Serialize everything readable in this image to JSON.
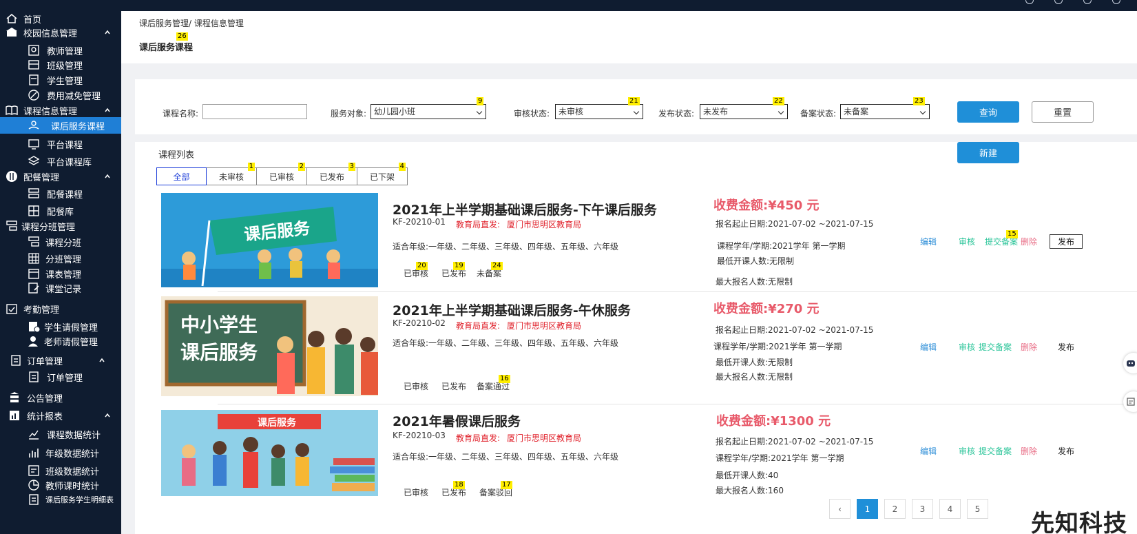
{
  "sidebar": {
    "items": [
      {
        "label": "首页",
        "level": 1,
        "icon": "home-icon"
      },
      {
        "label": "校园信息管理",
        "level": 1,
        "icon": "school-icon",
        "expanded": true
      },
      {
        "label": "教师管理",
        "level": 2,
        "icon": "teacher-icon"
      },
      {
        "label": "班级管理",
        "level": 2,
        "icon": "class-icon"
      },
      {
        "label": "学生管理",
        "level": 2,
        "icon": "student-icon"
      },
      {
        "label": "费用减免管理",
        "level": 2,
        "icon": "fee-icon"
      },
      {
        "label": "课程信息管理",
        "level": 1,
        "icon": "book-icon",
        "expanded": true
      },
      {
        "label": "课后服务课程",
        "level": 2,
        "icon": "service-icon",
        "active": true
      },
      {
        "label": "平台课程",
        "level": 2,
        "icon": "platform-icon"
      },
      {
        "label": "平台课程库",
        "level": 2,
        "icon": "layers-icon"
      },
      {
        "label": "配餐管理",
        "level": 1,
        "icon": "meal-icon",
        "expanded": true
      },
      {
        "label": "配餐课程",
        "level": 2,
        "icon": "meal-course-icon"
      },
      {
        "label": "配餐库",
        "level": 2,
        "icon": "grid-icon"
      },
      {
        "label": "课程分班管理",
        "level": 1,
        "icon": "split-icon"
      },
      {
        "label": "课程分班",
        "level": 2,
        "icon": "split-course-icon"
      },
      {
        "label": "分班管理",
        "level": 2,
        "icon": "grid2-icon"
      },
      {
        "label": "课表管理",
        "level": 2,
        "icon": "calendar-icon"
      },
      {
        "label": "课堂记录",
        "level": 2,
        "icon": "record-icon"
      },
      {
        "label": "考勤管理",
        "level": 1,
        "icon": "attendance-icon"
      },
      {
        "label": "学生请假管理",
        "level": 2,
        "icon": "leave-student-icon"
      },
      {
        "label": "老师请假管理",
        "level": 2,
        "icon": "leave-teacher-icon"
      },
      {
        "label": "订单管理",
        "level": 1,
        "icon": "order-icon",
        "expanded": true
      },
      {
        "label": "订单管理",
        "level": 2,
        "icon": "order-sub-icon"
      },
      {
        "label": "公告管理",
        "level": 1,
        "icon": "notice-icon"
      },
      {
        "label": "统计报表",
        "level": 1,
        "icon": "report-icon",
        "expanded": true
      },
      {
        "label": "课程数据统计",
        "level": 2,
        "icon": "chart-line-icon"
      },
      {
        "label": "年级数据统计",
        "level": 2,
        "icon": "chart-bar-icon"
      },
      {
        "label": "班级数据统计",
        "level": 2,
        "icon": "chart-class-icon"
      },
      {
        "label": "教师课时统计",
        "level": 2,
        "icon": "pie-icon"
      },
      {
        "label": "课后服务学生明细表",
        "level": 2,
        "icon": "detail-icon"
      }
    ]
  },
  "header": {
    "breadcrumb": "课后服务管理/ 课程信息管理",
    "title": "课后服务课程",
    "title_badge": "26"
  },
  "filters": {
    "name_label": "课程名称:",
    "name_value": "",
    "target_label": "服务对象:",
    "target_value": "幼儿园小班",
    "target_badge": "9",
    "audit_label": "审核状态:",
    "audit_value": "未审核",
    "audit_badge": "21",
    "publish_label": "发布状态:",
    "publish_value": "未发布",
    "publish_badge": "22",
    "record_label": "备案状态:",
    "record_value": "未备案",
    "record_badge": "23",
    "query_button": "查询",
    "reset_button": "重置"
  },
  "list": {
    "title": "课程列表",
    "new_button": "新建",
    "tabs": [
      {
        "label": "全部",
        "badge": ""
      },
      {
        "label": "未审核",
        "badge": "1"
      },
      {
        "label": "已审核",
        "badge": "2"
      },
      {
        "label": "已发布",
        "badge": "3"
      },
      {
        "label": "已下架",
        "badge": "4"
      }
    ],
    "courses": [
      {
        "title": "2021年上半学期基础课后服务-下午课后服务",
        "code": "KF-20210-01",
        "source_key": "教育局直发:",
        "source_value": "厦门市思明区教育局",
        "grades": "适合年级:一年级、二年级、三年级、四年级、五年级、六年级",
        "statuses": [
          {
            "text": "已审核",
            "badge": "20"
          },
          {
            "text": "已发布",
            "badge": "19"
          },
          {
            "text": "未备案",
            "badge": "24"
          }
        ],
        "price": "收费金额:¥450 元",
        "enroll_dates": "报名起止日期:2021-07-02 ~2021-07-15",
        "term": "课程学年/学期:2021学年 第一学期",
        "min_people": "最低开课人数:无限制",
        "max_people": "最大报名人数:无限制",
        "actions": {
          "edit": "编辑",
          "audit": "审核",
          "file": "提交备案",
          "file_badge": "15",
          "delete": "删除",
          "publish": "发布"
        },
        "image_text": "课后服务"
      },
      {
        "title": "2021年上半学期基础课后服务-午休服务",
        "code": "KF-20210-02",
        "source_key": "教育局直发:",
        "source_value": "厦门市思明区教育局",
        "grades": "适合年级:一年级、二年级、三年级、四年级、五年级、六年级",
        "statuses": [
          {
            "text": "已审核",
            "badge": ""
          },
          {
            "text": "已发布",
            "badge": ""
          },
          {
            "text": "备案通过",
            "badge": "16"
          }
        ],
        "price": "收费金额:¥270 元",
        "enroll_dates": "报名起止日期:2021-07-02 ~2021-07-15",
        "term": "课程学年/学期:2021学年 第一学期",
        "min_people": "最低开课人数:无限制",
        "max_people": "最大报名人数:无限制",
        "actions": {
          "edit": "编辑",
          "audit": "审核",
          "file": "提交备案",
          "file_badge": "",
          "delete": "删除",
          "publish": "发布"
        },
        "image_text_line1": "中小学生",
        "image_text_line2": "课后服务"
      },
      {
        "title": "2021年暑假课后服务",
        "code": "KF-20210-03",
        "source_key": "教育局直发:",
        "source_value": "厦门市思明区教育局",
        "grades": "适合年级:一年级、二年级、三年级、四年级、五年级、六年级",
        "statuses": [
          {
            "text": "已审核",
            "badge": ""
          },
          {
            "text": "已发布",
            "badge": "18"
          },
          {
            "text": "备案驳回",
            "badge": "17"
          }
        ],
        "price": "收费金额:¥1300 元",
        "enroll_dates": "报名起止日期:2021-07-02 ~2021-07-15",
        "term": "课程学年/学期:2021学年 第一学期",
        "min_people": "最低开课人数:40",
        "max_people": "最大报名人数:160",
        "actions": {
          "edit": "编辑",
          "audit": "审核",
          "file": "提交备案",
          "file_badge": "",
          "delete": "删除",
          "publish": "发布"
        },
        "image_text": "课后服务"
      }
    ]
  },
  "pagination": {
    "prev": "‹",
    "pages": [
      "1",
      "2",
      "3",
      "4",
      "5"
    ],
    "current": "1"
  },
  "watermark": "先知科技",
  "colors": {
    "sidebar_bg": "#0f1c30",
    "active": "#1f7fd6",
    "primary": "#1f8fd8",
    "price": "#e85a6a",
    "source": "#e0202a",
    "green": "#2cc59a",
    "delete": "#e86c85"
  }
}
